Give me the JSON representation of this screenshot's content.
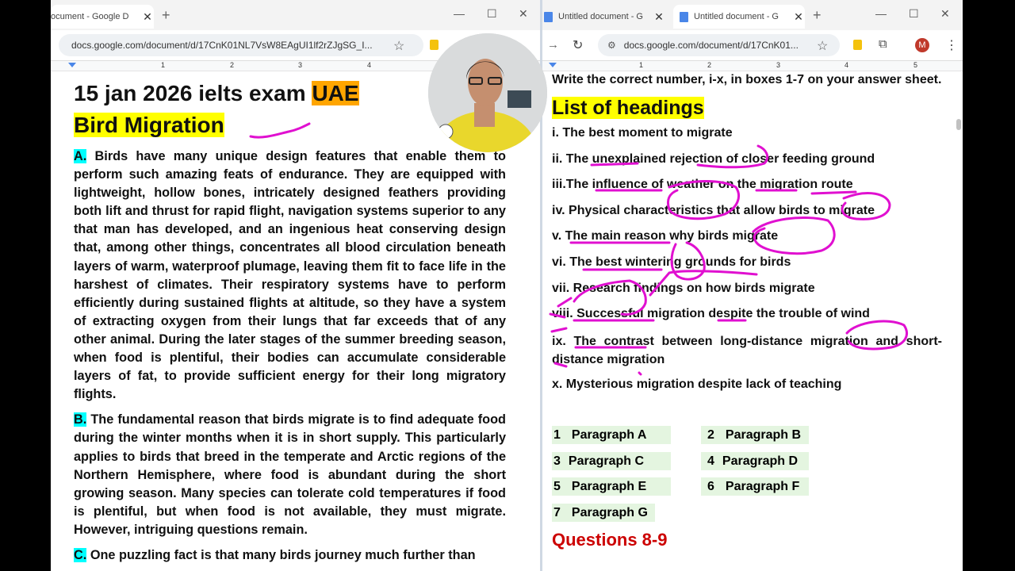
{
  "left": {
    "tab_title": "ocument - Google D",
    "url": "docs.google.com/document/d/17CnK01NL7VsW8EAgUI1lf2rZJgSG_I...",
    "ruler": [
      "1",
      "2",
      "3",
      "4"
    ],
    "heading_line1": "15 jan 2026 ielts exam ",
    "heading_uae": "UAE",
    "heading_line2": "Bird Migration",
    "para_a_label": "A.",
    "para_a": "Birds have many unique design features that enable them to perform such amazing feats of endurance. They are equipped with lightweight, hollow bones, intricately designed feathers providing both lift and thrust for rapid flight, navigation systems superior to any that man has developed, and an ingenious heat conserving design that, among other things, concentrates all blood circulation beneath layers of warm, waterproof plumage, leaving them fit to face life in the harshest of climates. Their respiratory systems have to perform efficiently during sustained flights at altitude, so they have a system of extracting oxygen from their lungs that far exceeds that of any other animal. During the later stages of the summer breeding season, when food is plentiful, their bodies can accumulate considerable layers of fat, to provide sufficient energy for their long migratory flights.",
    "para_b_label": "B.",
    "para_b": "The fundamental reason that birds migrate is to find adequate food during the winter months when it is in short supply. This particularly applies to birds that breed in the temperate and Arctic regions of the Northern Hemisphere, where food is abundant during the short growing season. Many species can tolerate cold temperatures if food is plentiful, but when food is not available, they must migrate. However, intriguing questions remain.",
    "para_c_label": "C.",
    "para_c": "One puzzling fact is that many birds journey much further than"
  },
  "right": {
    "tabs": [
      "Untitled document - G",
      "Untitled document - G"
    ],
    "url": "docs.google.com/document/d/17CnK01...",
    "profile_initial": "M",
    "ruler": [
      "1",
      "2",
      "3",
      "4",
      "5"
    ],
    "instruction": "Write the correct number, i-x, in boxes 1-7 on your answer sheet.",
    "headings_title": "List of headings",
    "headings": [
      "i. The best moment to migrate",
      "ii. The unexplained rejection of closer feeding ground",
      "iii.The influence of weather on the migration route",
      "iv. Physical characteristics that allow birds to migrate",
      "v. The main reason why birds migrate",
      "vi. The best wintering grounds for birds",
      "vii. Research findings on how birds migrate",
      "viii. Successful migration despite the trouble of wind"
    ],
    "heading_ix": "ix. The contrast between long-distance migration and short-distance migration",
    "heading_x": "x. Mysterious migration despite lack of teaching",
    "answers": [
      [
        "1",
        "Paragraph A"
      ],
      [
        "2",
        "Paragraph B"
      ],
      [
        "3",
        "Paragraph C"
      ],
      [
        "4",
        "Paragraph D"
      ],
      [
        "5",
        "Paragraph E"
      ],
      [
        "6",
        "Paragraph F"
      ],
      [
        "7",
        "Paragraph G"
      ]
    ],
    "questions_title": "Questions 8-9"
  },
  "colors": {
    "highlight_yellow": "#ffff00",
    "highlight_orange": "#ffa500",
    "highlight_cyan": "#00ffff",
    "answer_bg": "#e4f5e0",
    "questions_red": "#cc0000",
    "ink_magenta": "#e010d0",
    "docs_blue": "#4a86e8"
  },
  "icons": [
    "docs-icon",
    "close-icon",
    "new-tab-icon",
    "minimize-icon",
    "maximize-icon",
    "star-icon",
    "extension-icon",
    "menu-icon",
    "back-icon",
    "reload-icon",
    "site-info-icon",
    "profile-avatar"
  ]
}
